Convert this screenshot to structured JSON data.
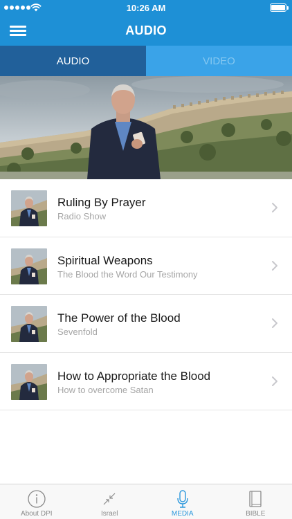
{
  "status_bar": {
    "time": "10:26 AM",
    "signal_icon": "signal-dots-icon",
    "wifi_icon": "wifi-icon",
    "battery_icon": "battery-icon",
    "battery_level": 1.0
  },
  "nav": {
    "title": "AUDIO",
    "menu_icon": "hamburger-menu-icon"
  },
  "tabs": [
    {
      "label": "AUDIO",
      "selected": true
    },
    {
      "label": "VIDEO",
      "selected": false
    }
  ],
  "hero": {
    "image": "speaker-in-front-of-jerusalem-walls"
  },
  "items": [
    {
      "title": "Ruling By Prayer",
      "subtitle": "Radio Show"
    },
    {
      "title": "Spiritual Weapons",
      "subtitle": "The Blood the Word Our Testimony"
    },
    {
      "title": "The Power of the Blood",
      "subtitle": "Sevenfold"
    },
    {
      "title": "How to Appropriate the Blood",
      "subtitle": "How to overcome Satan"
    }
  ],
  "tabbar": [
    {
      "label": "About DPI",
      "icon": "info-circle-icon",
      "active": false
    },
    {
      "label": "Israel",
      "icon": "arrows-in-icon",
      "active": false
    },
    {
      "label": "MEDIA",
      "icon": "microphone-icon",
      "active": true
    },
    {
      "label": "BIBLE",
      "icon": "book-icon",
      "active": false
    }
  ],
  "colors": {
    "header": "#1e90d6",
    "tab_selected": "#21609a",
    "tab_unselected": "#3aa3e8",
    "active_tint": "#2a97dc",
    "inactive_tint": "#8a8a8a"
  }
}
